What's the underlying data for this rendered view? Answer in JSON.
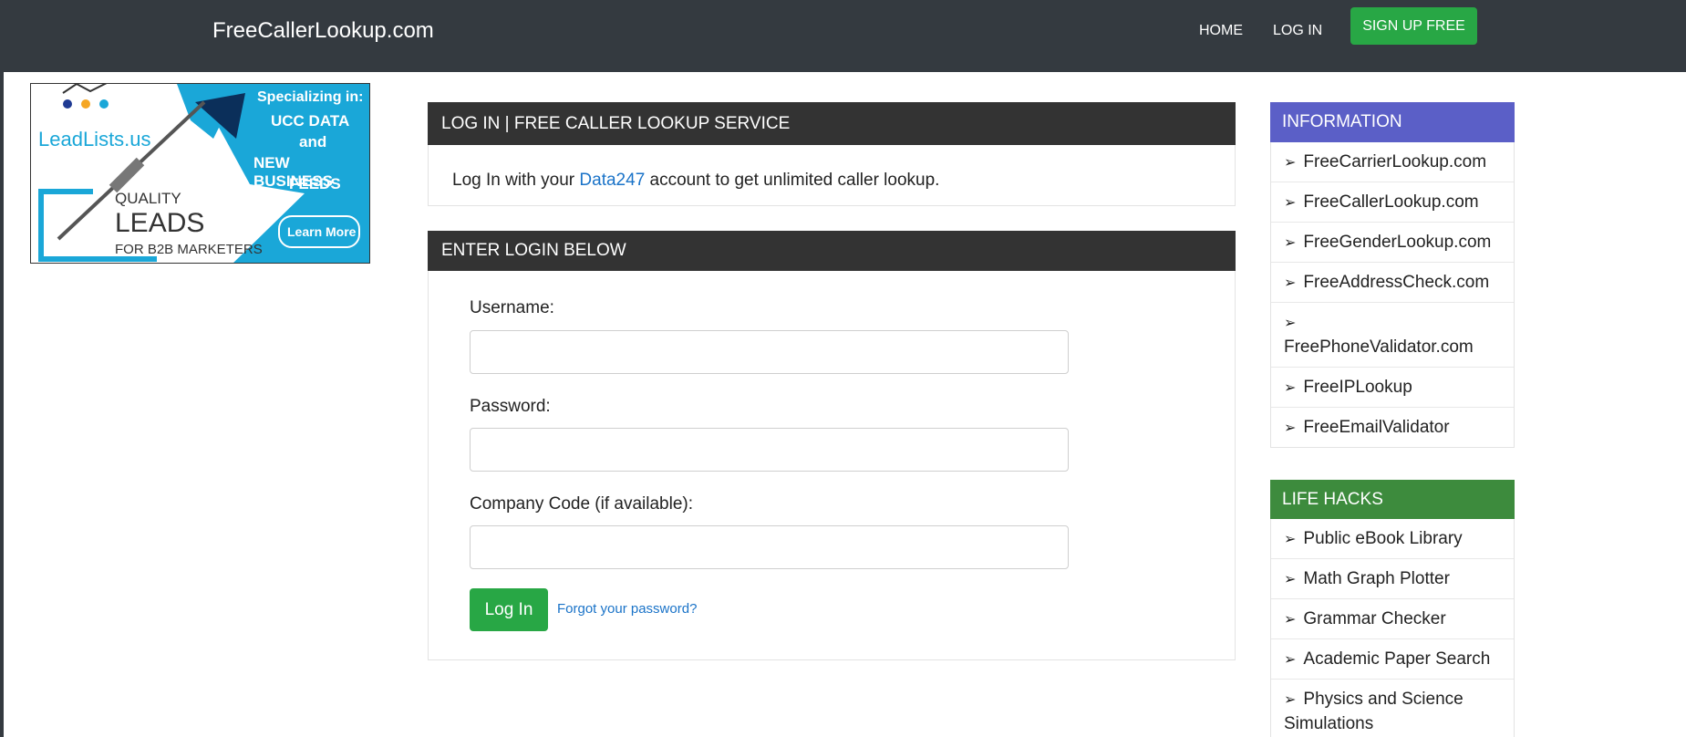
{
  "navbar": {
    "brand": "FreeCallerLookup.com",
    "links": [
      "HOME",
      "LOG IN"
    ],
    "signup": "SIGN UP FREE"
  },
  "ad": {
    "logo_text": "LeadLists.us",
    "line1": "Specializing in:",
    "line2": "UCC DATA",
    "line3": "and",
    "line4": "NEW BUSINESS",
    "line5": "FEEDS",
    "quality": "QUALITY",
    "leads": "LEADS",
    "b2b": "FOR B2B MARKETERS",
    "cta": "Learn More"
  },
  "login_panel": {
    "title": "LOG IN | FREE CALLER LOOKUP SERVICE",
    "intro_before": "Log In with your ",
    "intro_link": "Data247",
    "intro_after": " account to get unlimited caller lookup."
  },
  "form_panel": {
    "title": "ENTER LOGIN BELOW",
    "username_label": "Username:",
    "password_label": "Password:",
    "company_label": "Company Code (if available):",
    "username_value": "",
    "password_value": "",
    "company_value": "",
    "login_button": "Log In",
    "forgot_link": "Forgot your password?"
  },
  "sidebar": {
    "information": {
      "title": "INFORMATION",
      "color": "#5b5fc7",
      "items": [
        "FreeCarrierLookup.com",
        "FreeCallerLookup.com",
        "FreeGenderLookup.com",
        "FreeAddressCheck.com",
        "FreePhoneValidator.com",
        "FreeIPLookup",
        "FreeEmailValidator"
      ]
    },
    "life_hacks": {
      "title": "LIFE HACKS",
      "color": "#3d8b3d",
      "items": [
        "Public eBook Library",
        "Math Graph Plotter",
        "Grammar Checker",
        "Academic Paper Search",
        "Physics and Science Simulations"
      ]
    },
    "arrow_icon": "➢"
  }
}
